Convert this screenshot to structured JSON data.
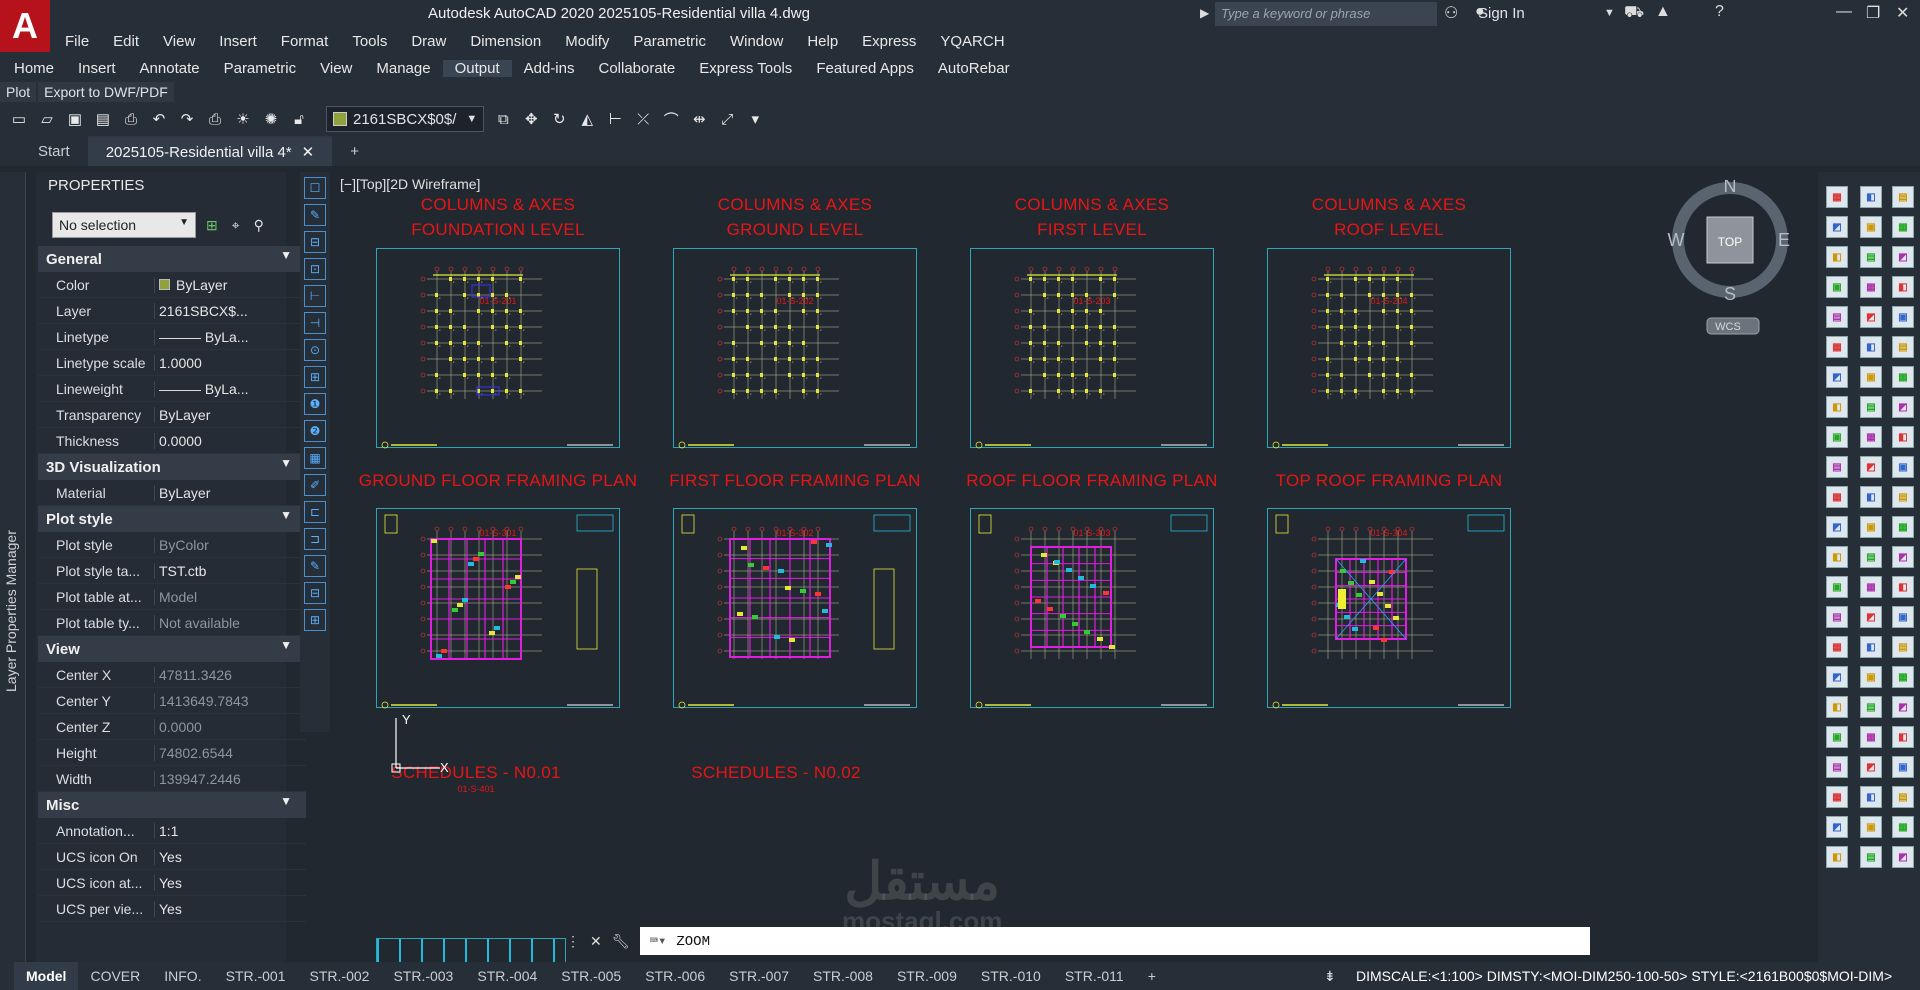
{
  "app": {
    "logo_letter": "A",
    "title": "Autodesk AutoCAD 2020    2025105-Residential villa 4.dwg",
    "search_placeholder": "Type a keyword or phrase",
    "sign_in": "Sign In"
  },
  "menu": [
    "File",
    "Edit",
    "View",
    "Insert",
    "Format",
    "Tools",
    "Draw",
    "Dimension",
    "Modify",
    "Parametric",
    "Window",
    "Help",
    "Express",
    "YQARCH"
  ],
  "ribbon_tabs": [
    "Home",
    "Insert",
    "Annotate",
    "Parametric",
    "View",
    "Manage",
    "Output",
    "Add-ins",
    "Collaborate",
    "Express Tools",
    "Featured Apps",
    "AutoRebar"
  ],
  "ribbon_active": "Output",
  "ribbon_panels": [
    "Plot",
    "Export to DWF/PDF"
  ],
  "quick_access": {
    "layer": "2161SBCX$0$/"
  },
  "doc_tabs": {
    "start": "Start",
    "active": "2025105-Residential villa 4*",
    "close": "✕",
    "add": "+"
  },
  "side_label": "Layer Properties Manager",
  "properties": {
    "header": "PROPERTIES",
    "selection": "No selection",
    "sections": [
      {
        "name": "General",
        "rows": [
          [
            "Color",
            "ByLayer"
          ],
          [
            "Layer",
            "2161SBCX$..."
          ],
          [
            "Linetype",
            "——— ByLa..."
          ],
          [
            "Linetype scale",
            "1.0000"
          ],
          [
            "Lineweight",
            "——— ByLa..."
          ],
          [
            "Transparency",
            "ByLayer"
          ],
          [
            "Thickness",
            "0.0000"
          ]
        ]
      },
      {
        "name": "3D Visualization",
        "rows": [
          [
            "Material",
            "ByLayer"
          ]
        ]
      },
      {
        "name": "Plot style",
        "rows": [
          [
            "Plot style",
            "ByColor"
          ],
          [
            "Plot style ta...",
            "TST.ctb"
          ],
          [
            "Plot table at...",
            "Model"
          ],
          [
            "Plot table ty...",
            "Not available"
          ]
        ]
      },
      {
        "name": "View",
        "rows": [
          [
            "Center X",
            "47811.3426"
          ],
          [
            "Center Y",
            "1413649.7843"
          ],
          [
            "Center Z",
            "0.0000"
          ],
          [
            "Height",
            "74802.6544"
          ],
          [
            "Width",
            "139947.2446"
          ]
        ]
      },
      {
        "name": "Misc",
        "rows": [
          [
            "Annotation...",
            "1:1"
          ],
          [
            "UCS icon On",
            "Yes"
          ],
          [
            "UCS icon at...",
            "Yes"
          ],
          [
            "UCS per vie...",
            "Yes"
          ]
        ]
      }
    ]
  },
  "viewport_label": "[−][Top][2D Wireframe]",
  "sheets": [
    {
      "t1": "COLUMNS & AXES",
      "t2": "FOUNDATION LEVEL",
      "code": "01-S-201"
    },
    {
      "t1": "COLUMNS & AXES",
      "t2": "GROUND LEVEL",
      "code": "01-S-202"
    },
    {
      "t1": "COLUMNS & AXES",
      "t2": "FIRST LEVEL",
      "code": "01-S-203"
    },
    {
      "t1": "COLUMNS & AXES",
      "t2": "ROOF LEVEL",
      "code": "01-S-204"
    },
    {
      "t1": "GROUND FLOOR FRAMING PLAN",
      "t2": "",
      "code": "01-S-301"
    },
    {
      "t1": "FIRST FLOOR FRAMING PLAN",
      "t2": "",
      "code": "01-S-302"
    },
    {
      "t1": "ROOF FLOOR FRAMING PLAN",
      "t2": "",
      "code": "01-S-303"
    },
    {
      "t1": "TOP ROOF FRAMING PLAN",
      "t2": "",
      "code": "01-S-304"
    }
  ],
  "schedules": [
    {
      "t": "SCHEDULES - N0.01",
      "code": "01-S-401"
    },
    {
      "t": "SCHEDULES - N0.02",
      "code": ""
    }
  ],
  "ucs": {
    "x": "X",
    "y": "Y"
  },
  "compass": {
    "n": "N",
    "s": "S",
    "e": "E",
    "w": "W",
    "top": "TOP",
    "wcs": "WCS"
  },
  "command": {
    "text": "ZOOM",
    "close": "✕"
  },
  "layout_tabs": [
    "Model",
    "COVER",
    "INFO.",
    "STR.-001",
    "STR.-002",
    "STR.-003",
    "STR.-004",
    "STR.-005",
    "STR.-006",
    "STR.-007",
    "STR.-008",
    "STR.-009",
    "STR.-010",
    "STR.-011"
  ],
  "layout_add": "+",
  "status_text": "DIMSCALE:<1:100> DIMSTY:<MOI-DIM250-100-50> STYLE:<2161B00$0$MOI-DIM>",
  "watermark": {
    "ar": "مستقل",
    "en": "mostaql.com"
  },
  "colors": {
    "accent": "#e81515",
    "sheet_border": "#2ea6b8",
    "axis_yellow": "#e6e63a",
    "beam_magenta": "#e01ee0"
  }
}
